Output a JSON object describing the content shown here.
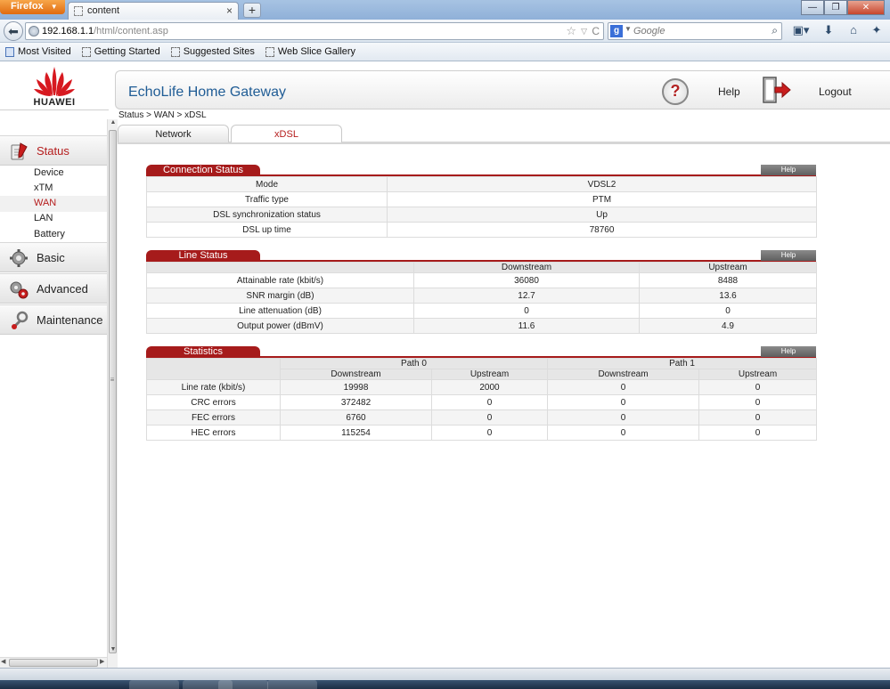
{
  "browser": {
    "menu_button": "Firefox",
    "tab_title": "content",
    "new_tab_symbol": "+",
    "url_host": "192.168.1.1",
    "url_path": "/html/content.asp",
    "search_placeholder": "Google",
    "bookmarks": [
      "Most Visited",
      "Getting Started",
      "Suggested Sites",
      "Web Slice Gallery"
    ]
  },
  "brand": {
    "logo_text": "HUAWEI",
    "accent": "#a61b1b",
    "title_color": "#1f5c95"
  },
  "header": {
    "title": "EchoLife Home Gateway",
    "help": "Help",
    "logout": "Logout"
  },
  "breadcrumb": "Status > WAN > xDSL",
  "tabs": [
    {
      "label": "Network",
      "active": false
    },
    {
      "label": "xDSL",
      "active": true
    }
  ],
  "sidebar": {
    "status": "Status",
    "status_items": [
      "Device",
      "xTM",
      "WAN",
      "LAN",
      "Battery"
    ],
    "active_item": "WAN",
    "basic": "Basic",
    "advanced": "Advanced",
    "maintenance": "Maintenance"
  },
  "help_button": "Help",
  "connection_status": {
    "title": "Connection Status",
    "rows": [
      {
        "label": "Mode",
        "value": "VDSL2"
      },
      {
        "label": "Traffic type",
        "value": "PTM"
      },
      {
        "label": "DSL synchronization status",
        "value": "Up"
      },
      {
        "label": "DSL up time",
        "value": "78760"
      }
    ]
  },
  "line_status": {
    "title": "Line Status",
    "headers": [
      "Downstream",
      "Upstream"
    ],
    "rows": [
      {
        "label": "Attainable rate (kbit/s)",
        "down": "36080",
        "up": "8488"
      },
      {
        "label": "SNR margin (dB)",
        "down": "12.7",
        "up": "13.6"
      },
      {
        "label": "Line attenuation (dB)",
        "down": "0",
        "up": "0"
      },
      {
        "label": "Output power (dBmV)",
        "down": "11.6",
        "up": "4.9"
      }
    ]
  },
  "statistics": {
    "title": "Statistics",
    "path0": "Path 0",
    "path1": "Path 1",
    "sub_headers": [
      "Downstream",
      "Upstream",
      "Downstream",
      "Upstream"
    ],
    "rows": [
      {
        "label": "Line rate (kbit/s)",
        "p0_down": "19998",
        "p0_up": "2000",
        "p1_down": "0",
        "p1_up": "0"
      },
      {
        "label": "CRC errors",
        "p0_down": "372482",
        "p0_up": "0",
        "p1_down": "0",
        "p1_up": "0"
      },
      {
        "label": "FEC errors",
        "p0_down": "6760",
        "p0_up": "0",
        "p1_down": "0",
        "p1_up": "0"
      },
      {
        "label": "HEC errors",
        "p0_down": "115254",
        "p0_up": "0",
        "p1_down": "0",
        "p1_up": "0"
      }
    ]
  }
}
